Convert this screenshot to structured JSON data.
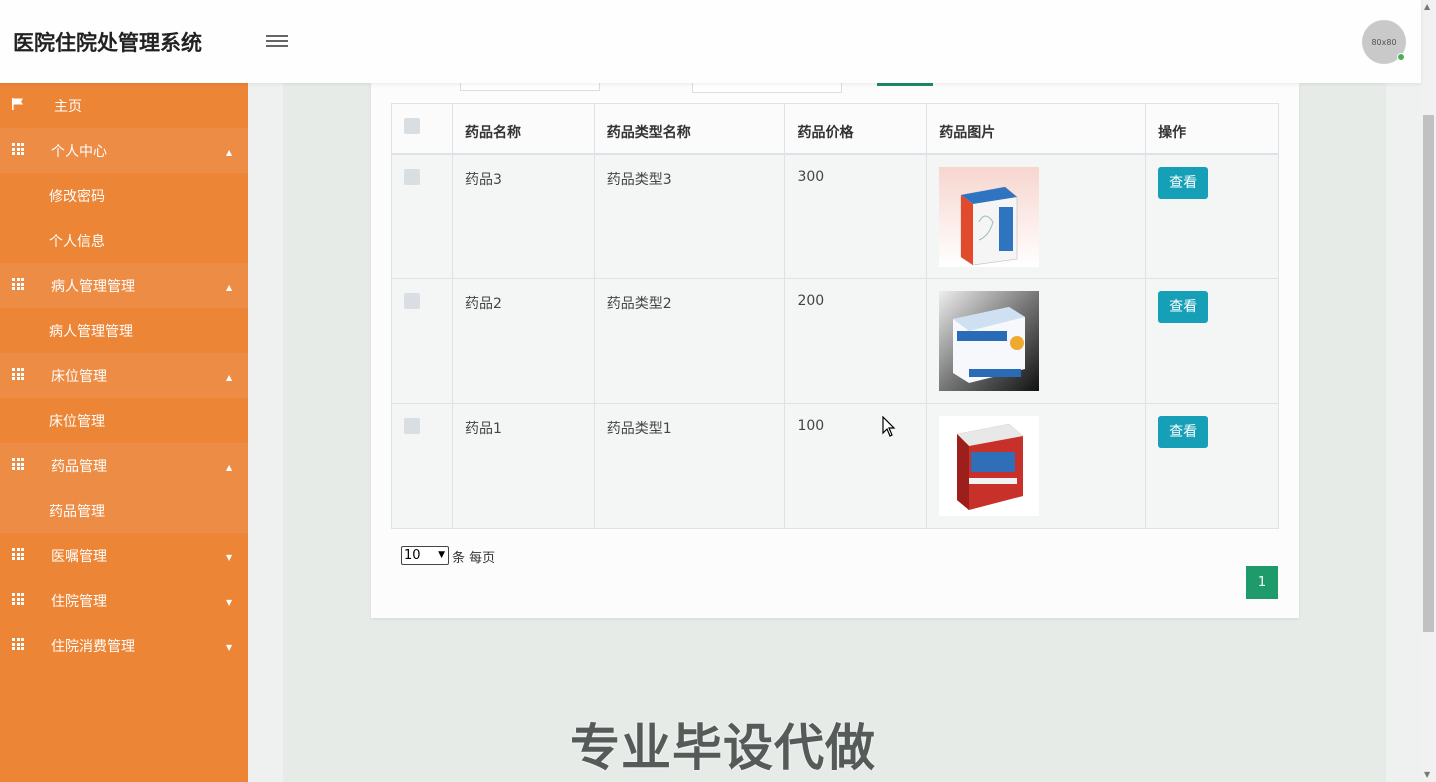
{
  "header": {
    "title": "医院住院处管理系统",
    "avatar_text": "80x80"
  },
  "sidebar": {
    "home": "主页",
    "groups": [
      {
        "label": "个人中心",
        "expanded": true,
        "items": [
          "修改密码",
          "个人信息"
        ]
      },
      {
        "label": "病人管理管理",
        "expanded": true,
        "items": [
          "病人管理管理"
        ]
      },
      {
        "label": "床位管理",
        "expanded": true,
        "items": [
          "床位管理"
        ]
      },
      {
        "label": "药品管理",
        "expanded": true,
        "items": [
          "药品管理"
        ]
      },
      {
        "label": "医嘱管理",
        "expanded": false,
        "items": []
      },
      {
        "label": "住院管理",
        "expanded": false,
        "items": []
      },
      {
        "label": "住院消费管理",
        "expanded": false,
        "items": []
      }
    ]
  },
  "table": {
    "headers": [
      "药品名称",
      "药品类型名称",
      "药品价格",
      "药品图片",
      "操作"
    ],
    "rows": [
      {
        "name": "药品3",
        "type": "药品类型3",
        "price": "300",
        "action": "查看"
      },
      {
        "name": "药品2",
        "type": "药品类型2",
        "price": "200",
        "action": "查看"
      },
      {
        "name": "药品1",
        "type": "药品类型1",
        "price": "100",
        "action": "查看"
      }
    ]
  },
  "pager": {
    "page_size": "10",
    "per_page_text": "条 每页",
    "current_page": "1"
  },
  "watermark": "专业毕设代做",
  "colors": {
    "sidebar": "#ec8535",
    "accent_green": "#1f9a6a",
    "view_button": "#16a0b8"
  }
}
